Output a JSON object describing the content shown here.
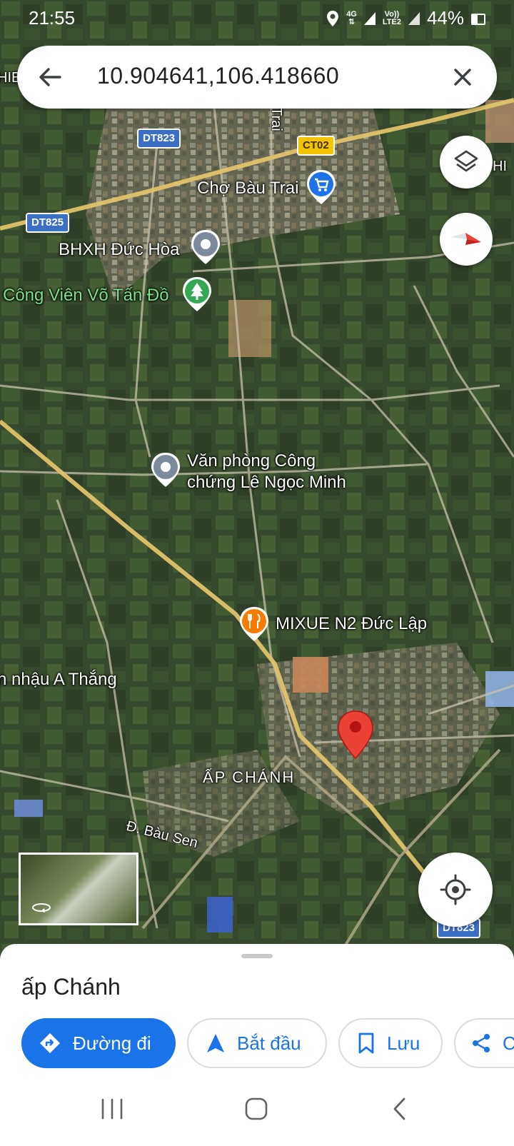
{
  "status_bar": {
    "time": "21:55",
    "network_top": "4G",
    "volte_top": "Vo))",
    "volte_bottom": "LTE2",
    "battery": "44%"
  },
  "search": {
    "query": "10.904641,106.418660"
  },
  "map": {
    "road_shields": [
      {
        "text": "DT823",
        "style": "blue"
      },
      {
        "text": "CT02",
        "style": "yellow"
      },
      {
        "text": "DT825",
        "style": "blue"
      },
      {
        "text": "DT823",
        "style": "blue"
      }
    ],
    "places": {
      "market": "Chợ Bàu Trai",
      "office": "BHXH Đức Hòa",
      "park": "Công Viên Võ Tấn Đồ",
      "notary_line1": "Văn phòng Công",
      "notary_line2": "chứng Lê Ngọc Minh",
      "restaurant": "MIXUE N2 Đức Lập",
      "pub": "n nhậu A Thắng",
      "area": "ẤP CHÁNH",
      "street": "Đ. Bàu Sen",
      "edge_left": "HIE",
      "edge_right": "HI",
      "road_trai": "Trai"
    },
    "colors": {
      "pin_red": "#ea4335",
      "accent_blue": "#1a73e8",
      "park_green": "#34a853",
      "food_orange": "#f57c00"
    }
  },
  "sheet": {
    "title": "ấp Chánh",
    "buttons": {
      "directions": "Đường đi",
      "start": "Bắt đầu",
      "save": "Lưu",
      "share": "C"
    }
  }
}
